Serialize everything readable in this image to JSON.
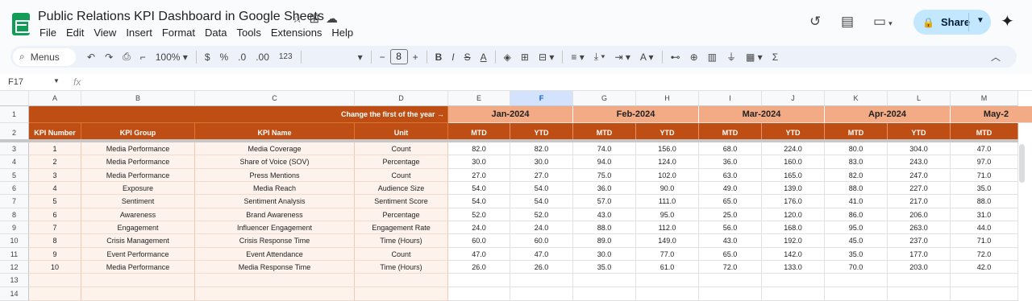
{
  "app": {
    "title": "Public Relations KPI Dashboard in Google Sheets",
    "menu": [
      "File",
      "Edit",
      "View",
      "Insert",
      "Format",
      "Data",
      "Tools",
      "Extensions",
      "Help"
    ],
    "share_label": "Share"
  },
  "toolbar": {
    "menus_label": "Menus",
    "zoom": "100%",
    "currency": "$",
    "percent": "%",
    "dec_decrease": ".0",
    "dec_increase": ".00",
    "number_format": "123",
    "font_size": "8",
    "bold": "B",
    "italic": "I",
    "strike": "S",
    "text_color": "A"
  },
  "formula_bar": {
    "cell_ref": "F17",
    "fx": "fx",
    "value": ""
  },
  "columns": [
    "A",
    "B",
    "C",
    "D",
    "E",
    "F",
    "G",
    "H",
    "I",
    "J",
    "K",
    "L",
    "M"
  ],
  "selected_column": "F",
  "row_numbers": [
    "1",
    "2",
    "3",
    "4",
    "5",
    "6",
    "7",
    "8",
    "9",
    "10",
    "11",
    "12",
    "13",
    "14"
  ],
  "sheet": {
    "change_label": "Change the first of the year →",
    "months": [
      "Jan-2024",
      "Feb-2024",
      "Mar-2024",
      "Apr-2024",
      "May-2"
    ],
    "headers": [
      "KPI Number",
      "KPI Group",
      "KPI Name",
      "Unit"
    ],
    "sub_headers": [
      "MTD",
      "YTD",
      "MTD",
      "YTD",
      "MTD",
      "YTD",
      "MTD",
      "YTD",
      "MTD"
    ],
    "rows": [
      {
        "num": "1",
        "group": "Media Performance",
        "name": "Media Coverage",
        "unit": "Count",
        "values": [
          "82.0",
          "82.0",
          "74.0",
          "156.0",
          "68.0",
          "224.0",
          "80.0",
          "304.0",
          "47.0"
        ]
      },
      {
        "num": "2",
        "group": "Media Performance",
        "name": "Share of Voice (SOV)",
        "unit": "Percentage",
        "values": [
          "30.0",
          "30.0",
          "94.0",
          "124.0",
          "36.0",
          "160.0",
          "83.0",
          "243.0",
          "97.0"
        ]
      },
      {
        "num": "3",
        "group": "Media Performance",
        "name": "Press Mentions",
        "unit": "Count",
        "values": [
          "27.0",
          "27.0",
          "75.0",
          "102.0",
          "63.0",
          "165.0",
          "82.0",
          "247.0",
          "71.0"
        ]
      },
      {
        "num": "4",
        "group": "Exposure",
        "name": "Media Reach",
        "unit": "Audience Size",
        "values": [
          "54.0",
          "54.0",
          "36.0",
          "90.0",
          "49.0",
          "139.0",
          "88.0",
          "227.0",
          "35.0"
        ]
      },
      {
        "num": "5",
        "group": "Sentiment",
        "name": "Sentiment Analysis",
        "unit": "Sentiment Score",
        "values": [
          "54.0",
          "54.0",
          "57.0",
          "111.0",
          "65.0",
          "176.0",
          "41.0",
          "217.0",
          "88.0"
        ]
      },
      {
        "num": "6",
        "group": "Awareness",
        "name": "Brand Awareness",
        "unit": "Percentage",
        "values": [
          "52.0",
          "52.0",
          "43.0",
          "95.0",
          "25.0",
          "120.0",
          "86.0",
          "206.0",
          "31.0"
        ]
      },
      {
        "num": "7",
        "group": "Engagement",
        "name": "Influencer Engagement",
        "unit": "Engagement Rate",
        "values": [
          "24.0",
          "24.0",
          "88.0",
          "112.0",
          "56.0",
          "168.0",
          "95.0",
          "263.0",
          "44.0"
        ]
      },
      {
        "num": "8",
        "group": "Crisis Management",
        "name": "Crisis Response Time",
        "unit": "Time (Hours)",
        "values": [
          "60.0",
          "60.0",
          "89.0",
          "149.0",
          "43.0",
          "192.0",
          "45.0",
          "237.0",
          "71.0"
        ]
      },
      {
        "num": "9",
        "group": "Event Performance",
        "name": "Event Attendance",
        "unit": "Count",
        "values": [
          "47.0",
          "47.0",
          "30.0",
          "77.0",
          "65.0",
          "142.0",
          "35.0",
          "177.0",
          "72.0"
        ]
      },
      {
        "num": "10",
        "group": "Media Performance",
        "name": "Media Response Time",
        "unit": "Time (Hours)",
        "values": [
          "26.0",
          "26.0",
          "35.0",
          "61.0",
          "72.0",
          "133.0",
          "70.0",
          "203.0",
          "42.0"
        ]
      }
    ]
  }
}
